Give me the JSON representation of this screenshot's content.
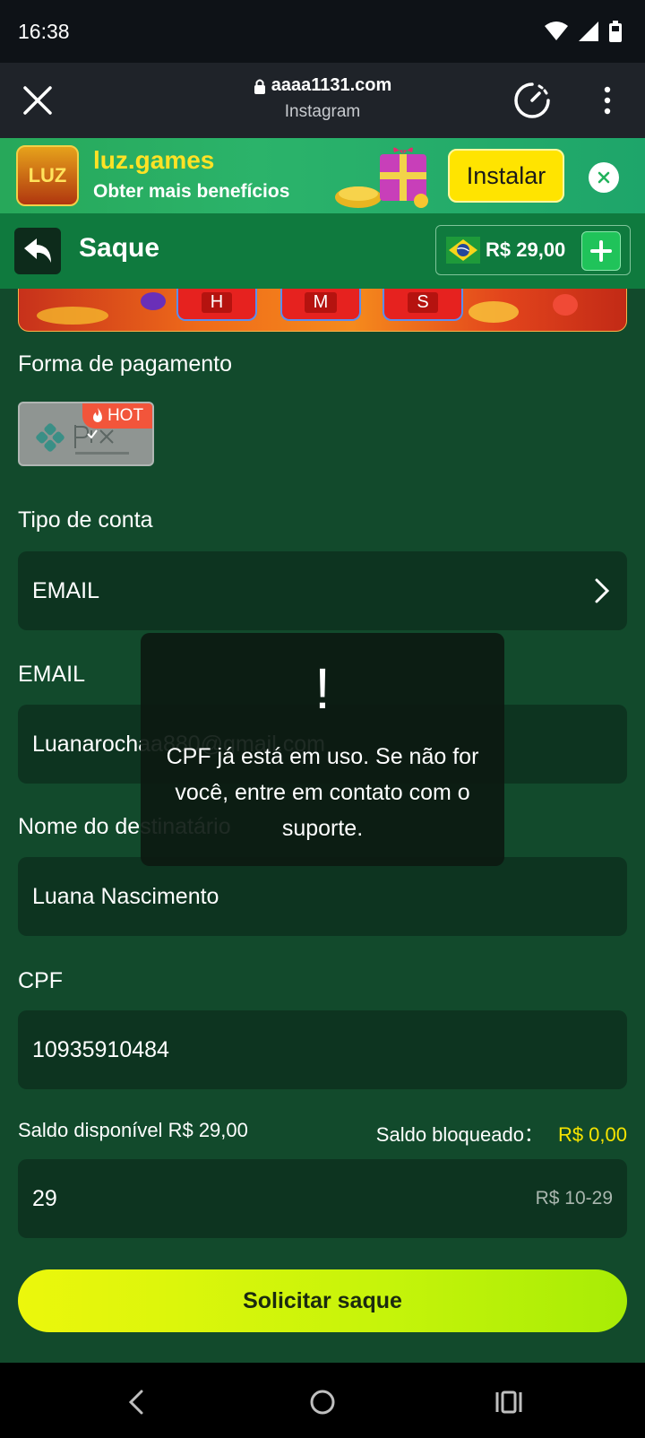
{
  "status": {
    "time": "16:38"
  },
  "browser": {
    "url": "aaaa1131.com",
    "source": "Instagram"
  },
  "promo": {
    "logo_text": "LUZ",
    "title": "luz.games",
    "subtitle": "Obter mais benefícios",
    "install_label": "Instalar"
  },
  "header": {
    "title": "Saque",
    "balance": "R$ 29,00"
  },
  "banner": {
    "timers": [
      "H",
      "M",
      "S"
    ]
  },
  "payment": {
    "label": "Forma de pagamento",
    "method": "pix",
    "badge": "HOT"
  },
  "account_type": {
    "label": "Tipo de conta",
    "value": "EMAIL"
  },
  "email": {
    "label": "EMAIL",
    "value": "Luanarochaa880@gmail.com"
  },
  "recipient": {
    "label": "Nome do destinatário",
    "value": "Luana Nascimento"
  },
  "cpf": {
    "label": "CPF",
    "value": "10935910484"
  },
  "saldo": {
    "available_label": "Saldo disponível",
    "available_value": "R$ 29,00",
    "blocked_label": "Saldo bloqueado：",
    "blocked_value": "R$ 0,00"
  },
  "amount": {
    "value": "29",
    "hint": "R$ 10-29"
  },
  "submit_label": "Solicitar saque",
  "toast": {
    "mark": "!",
    "message": "CPF já está em uso. Se não for você, entre em contato com o suporte."
  },
  "colors": {
    "page_bg": "#124a2c",
    "header_bg": "#0f7a3e",
    "accent_yellow": "#f6e400",
    "field_bg": "#0d3420"
  }
}
